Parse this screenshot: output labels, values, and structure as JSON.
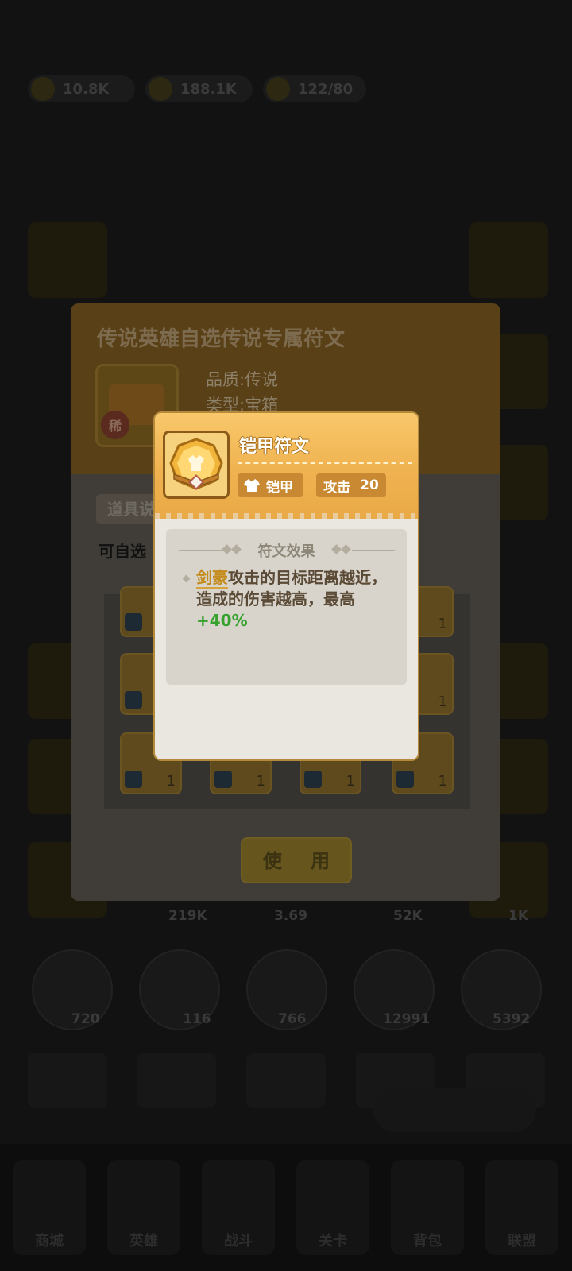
{
  "resources": [
    {
      "icon": "gem-icon",
      "value": "10.8K"
    },
    {
      "icon": "coin-icon",
      "value": "188.1K"
    },
    {
      "icon": "stamina-icon",
      "value": "122/80"
    }
  ],
  "background_values": [
    "219K",
    "3.69",
    "52K",
    "1K",
    "720",
    "116",
    "766",
    "12991",
    "5392"
  ],
  "bottom_nav": [
    "商城",
    "英雄",
    "战斗",
    "关卡",
    "背包",
    "联盟"
  ],
  "chest_dialog": {
    "title": "传说英雄自选传说专属符文",
    "rarity_badge": "稀",
    "quality_label": "品质:传说",
    "type_label": "类型:宝箱",
    "tab_label": "道具说",
    "select_desc": "可自选",
    "item_counts": [
      "1",
      "1",
      "1",
      "1",
      "1",
      "1",
      "1",
      "1",
      "1",
      "1"
    ],
    "use_button": "使 用"
  },
  "rune_popup": {
    "name": "铠甲符文",
    "type_tag": "铠甲",
    "stat_name": "攻击",
    "stat_value": "20",
    "effect_title": "符文效果",
    "effect_keyword": "剑豪",
    "effect_text_1": "攻击的目标距离越近，造成的伤害越高，最高",
    "effect_bonus": "+40%"
  },
  "colors": {
    "popup_header": "#f0b250",
    "tag_bg": "#c98933",
    "keyword": "#c48a1a",
    "bonus": "#34a22c"
  }
}
